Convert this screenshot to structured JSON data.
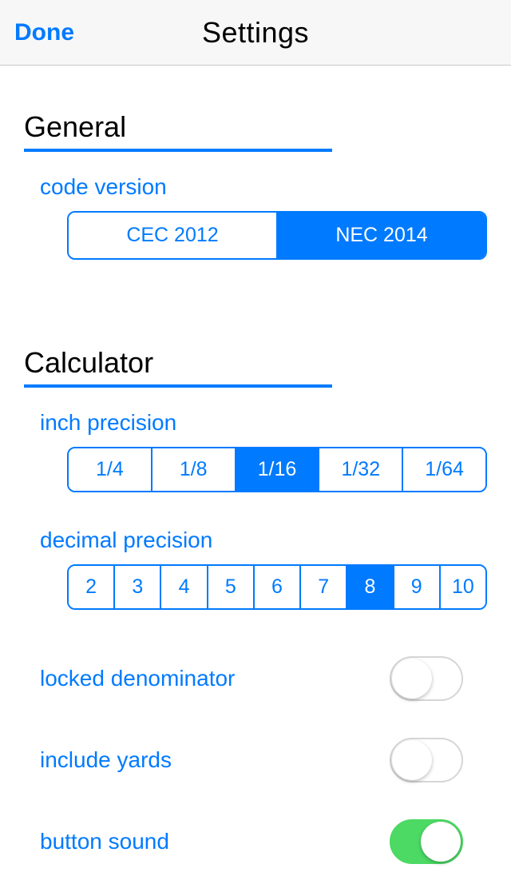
{
  "navbar": {
    "done": "Done",
    "title": "Settings"
  },
  "general": {
    "header": "General",
    "code_version_label": "code version",
    "code_version_options": [
      "CEC 2012",
      "NEC 2014"
    ],
    "code_version_selected": "NEC 2014"
  },
  "calculator": {
    "header": "Calculator",
    "inch_precision_label": "inch precision",
    "inch_precision_options": [
      "1/4",
      "1/8",
      "1/16",
      "1/32",
      "1/64"
    ],
    "inch_precision_selected": "1/16",
    "decimal_precision_label": "decimal precision",
    "decimal_precision_options": [
      "2",
      "3",
      "4",
      "5",
      "6",
      "7",
      "8",
      "9",
      "10"
    ],
    "decimal_precision_selected": "8",
    "locked_denominator_label": "locked denominator",
    "locked_denominator_value": false,
    "include_yards_label": "include yards",
    "include_yards_value": false,
    "button_sound_label": "button sound",
    "button_sound_value": true
  }
}
